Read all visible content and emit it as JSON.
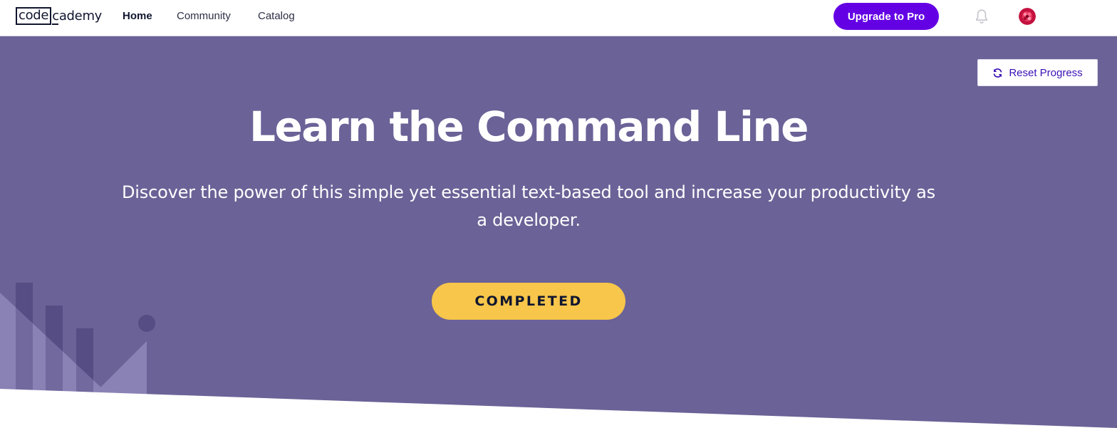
{
  "nav": {
    "logo_left": "code",
    "logo_right": "cademy",
    "links": [
      {
        "label": "Home",
        "active": true
      },
      {
        "label": "Community",
        "active": false
      },
      {
        "label": "Catalog",
        "active": false
      }
    ],
    "upgrade_label": "Upgrade to Pro",
    "icons": {
      "notifications": "bell-icon",
      "profile": "avatar"
    }
  },
  "hero": {
    "reset_label": "Reset Progress",
    "title": "Learn the Command Line",
    "description": "Discover the power of this simple yet essential text-based tool and increase your productivity as a developer.",
    "status_button": "COMPLETED"
  },
  "colors": {
    "brand_purple": "#6400e4",
    "hero_background": "#6b6297",
    "completed_yellow": "#f7c64a",
    "reset_text": "#3a10b5",
    "text_dark": "#10162f"
  }
}
